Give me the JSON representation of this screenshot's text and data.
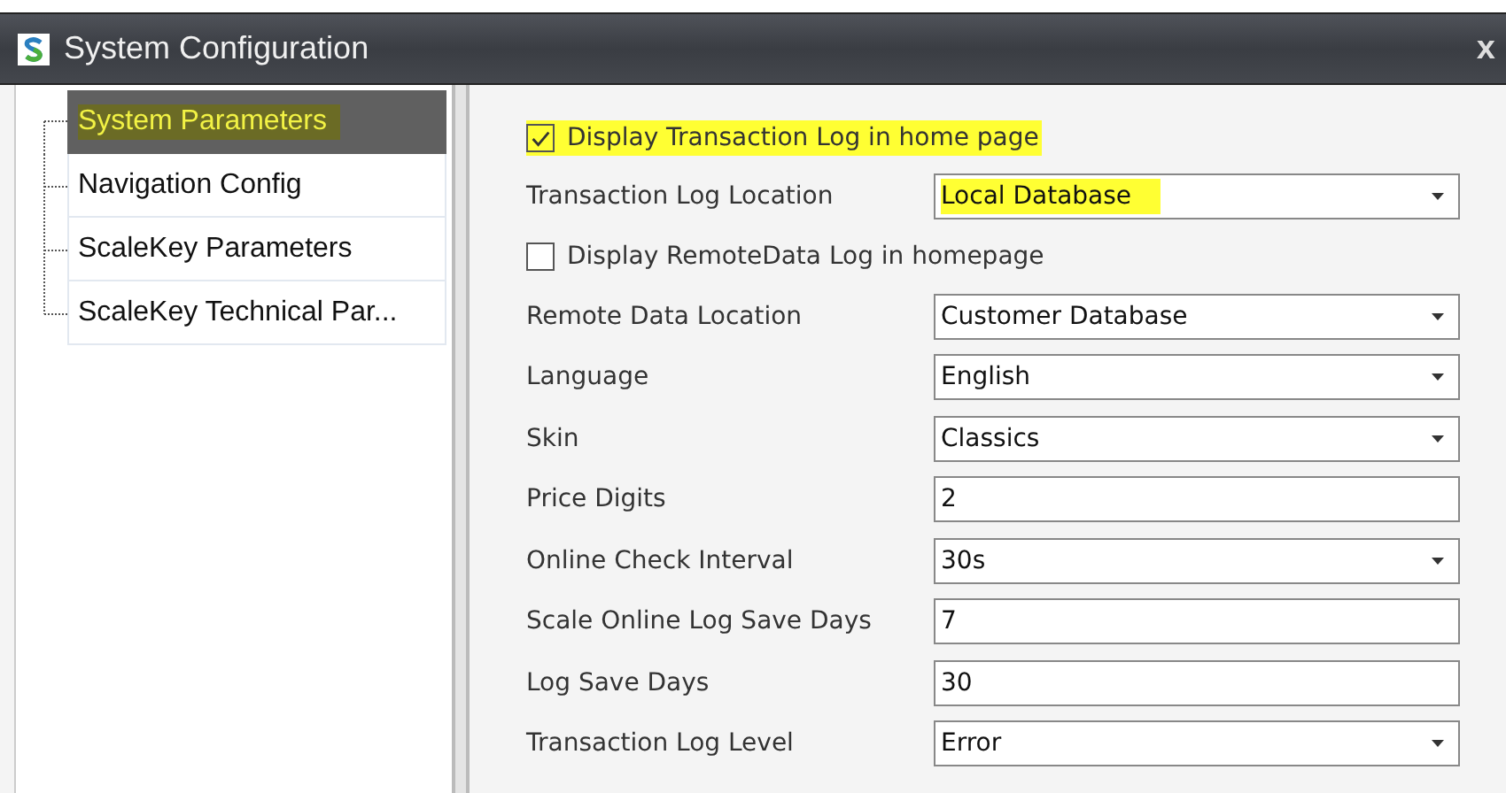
{
  "window": {
    "title": "System Configuration",
    "close": "x"
  },
  "tree": [
    {
      "label": "System Parameters",
      "selected": true
    },
    {
      "label": "Navigation Config",
      "selected": false
    },
    {
      "label": "ScaleKey Parameters",
      "selected": false
    },
    {
      "label": "ScaleKey Technical Par...",
      "selected": false
    }
  ],
  "settings": [
    {
      "kind": "checkbox",
      "label": "Display Transaction Log in home page",
      "checked": true,
      "highlighted": true
    },
    {
      "kind": "dropdown",
      "label": "Transaction Log Location",
      "value": "Local Database",
      "highlighted": true
    },
    {
      "kind": "checkbox",
      "label": "Display RemoteData Log in homepage",
      "checked": false,
      "highlighted": false
    },
    {
      "kind": "dropdown",
      "label": "Remote Data Location",
      "value": "Customer Database",
      "highlighted": false
    },
    {
      "kind": "dropdown",
      "label": "Language",
      "value": "English",
      "highlighted": false
    },
    {
      "kind": "dropdown",
      "label": "Skin",
      "value": "Classics",
      "highlighted": false
    },
    {
      "kind": "text",
      "label": "Price Digits",
      "value": "2"
    },
    {
      "kind": "dropdown",
      "label": "Online Check Interval",
      "value": "30s",
      "highlighted": false
    },
    {
      "kind": "text",
      "label": "Scale Online Log Save Days",
      "value": "7"
    },
    {
      "kind": "text",
      "label": "Log Save Days",
      "value": "30"
    },
    {
      "kind": "dropdown",
      "label": "Transaction Log Level",
      "value": "Error",
      "highlighted": false
    }
  ]
}
